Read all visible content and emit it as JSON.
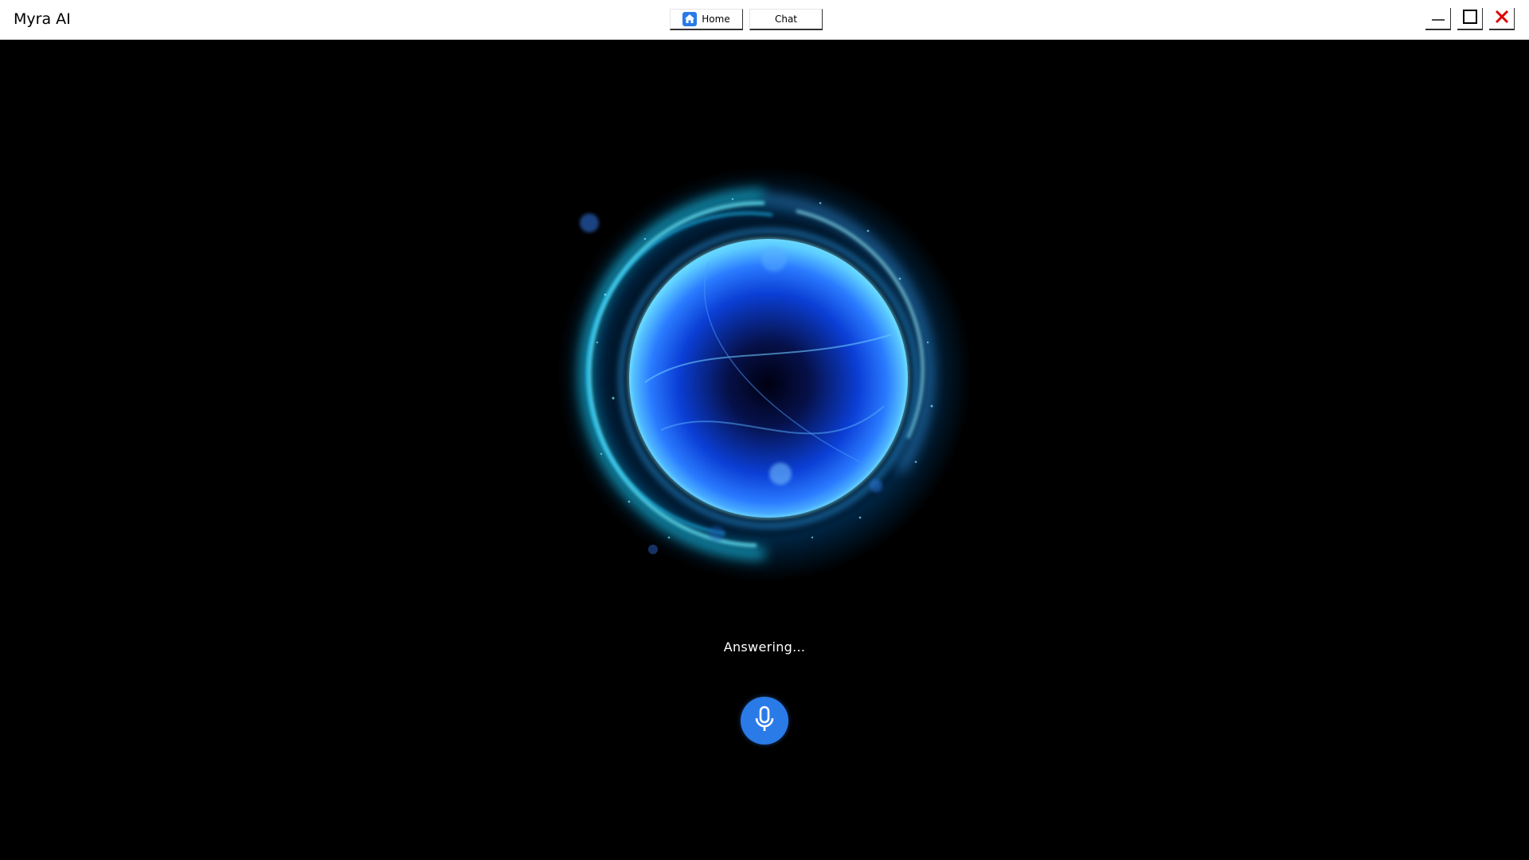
{
  "window": {
    "title": "Myra AI"
  },
  "nav": {
    "home_label": "Home",
    "chat_label": "Chat"
  },
  "status": {
    "text": "Answering..."
  },
  "icons": {
    "home": "home-icon",
    "minimize": "minimize-icon",
    "maximize": "maximize-icon",
    "close": "close-icon",
    "mic": "microphone-icon"
  },
  "colors": {
    "titlebar_bg": "#ffffff",
    "stage_bg": "#000000",
    "accent": "#2a7be8",
    "close_red": "#e00000",
    "orb_core": "#1a5cff",
    "orb_glow": "#2ad4ff"
  }
}
